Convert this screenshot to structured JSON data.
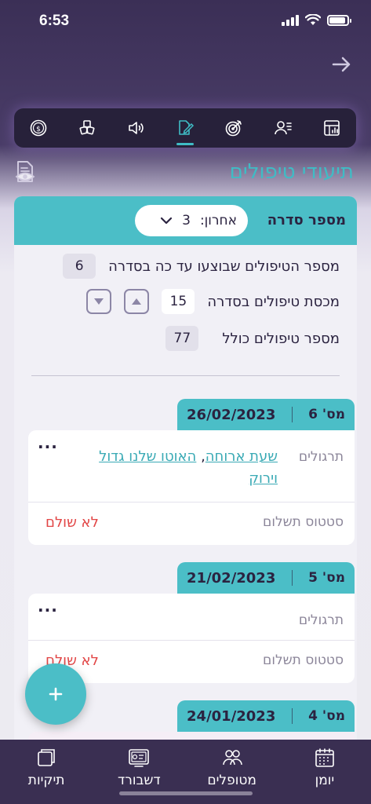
{
  "status_bar": {
    "time": "6:53"
  },
  "header": {
    "title": "תיעודי טיפולים"
  },
  "series": {
    "label": "מספר סדרה",
    "select_prefix": "אחרון:",
    "select_value": "3"
  },
  "stats": {
    "done_label": "מספר הטיפולים שבוצעו עד כה בסדרה",
    "done_value": "6",
    "quota_label": "מכסת טיפולים בסדרה",
    "quota_value": "15",
    "total_label": "מספר טיפולים כולל",
    "total_value": "77"
  },
  "sessions": [
    {
      "num": "מס' 6",
      "date": "26/02/2023",
      "exercises_label": "תרגולים",
      "exercises": [
        "שעת ארוחה",
        "האוטו שלנו גדול וירוק"
      ],
      "payment_label": "סטטוס תשלום",
      "payment_status": "לא שולם"
    },
    {
      "num": "מס' 5",
      "date": "21/02/2023",
      "exercises_label": "תרגולים",
      "exercises": [],
      "payment_label": "סטטוס תשלום",
      "payment_status": "לא שולם"
    },
    {
      "num": "מס' 4",
      "date": "24/01/2023"
    }
  ],
  "more_glyph": "...",
  "comma": ",",
  "bottom_nav": [
    {
      "label": "תיקיות",
      "icon": "folders-icon"
    },
    {
      "label": "דשבורד",
      "icon": "dashboard-icon"
    },
    {
      "label": "מטופלים",
      "icon": "patients-icon"
    },
    {
      "label": "יומן",
      "icon": "calendar-icon"
    }
  ],
  "colors": {
    "accent": "#4bbec7",
    "dark_bg": "#3b2f56",
    "unpaid": "#e24646"
  }
}
